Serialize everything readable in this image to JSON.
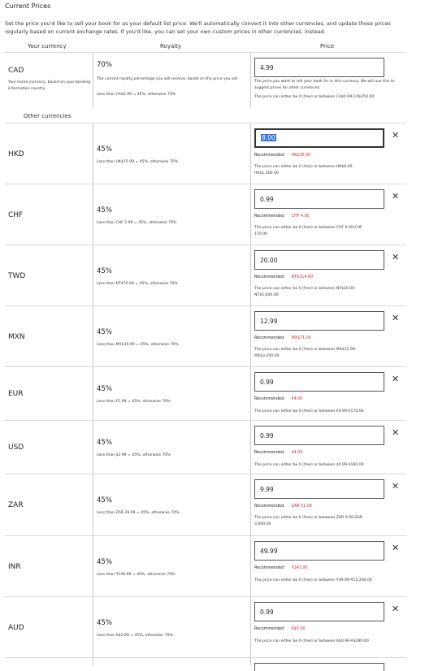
{
  "header": {
    "title": "Current Prices",
    "intro": "Set the price you'd like to sell your book for as your default list price. We'll automatically convert it into other currencies, and update those prices regularly based on current exchange rates. If you'd like, you can set your own custom prices in other currencies, instead."
  },
  "columns": {
    "your_currency": "Your currency",
    "royalty": "Royalty",
    "price": "Price"
  },
  "home": {
    "currency": "CAD",
    "currency_desc": "Your home currency, based on your banking information country.",
    "royalty": "70%",
    "royalty_desc": "The current royalty percentage you will receive, based on the price you set.",
    "royalty_rule": "Less than CA$2.99 = 45%, otherwise 70%",
    "price": "4.99",
    "price_desc": "The price you want to sell your book for in this currency. We will use this to suggest prices for other currencies.",
    "price_range": "The price can either be 0 (free) or between CA$0.99-CA$250.00"
  },
  "other_label": "Other currencies",
  "recommended_label": "Recommended:",
  "rows": [
    {
      "currency": "HKD",
      "royalty": "45%",
      "rule": "Less than HK$15.99 = 45%, otherwise 70%",
      "price": "8.00",
      "recommended": "HK$30.00",
      "range": "The price can either be 0 (free) or between HK$8.00-HK$1,500.00"
    },
    {
      "currency": "CHF",
      "royalty": "45%",
      "rule": "Less than CHF 2.99 = 45%, otherwise 70%",
      "price": "0.99",
      "recommended": "CHF 4.00",
      "range": "The price can either be 0 (free) or between CHF 0.99-CHF 170.00"
    },
    {
      "currency": "TWD",
      "royalty": "45%",
      "rule": "Less than NT$70.00 = 45%, otherwise 70%",
      "price": "20.00",
      "recommended": "NT$114.00",
      "range": "The price can either be 0 (free) or between NT$20.00-NT$5,600.00"
    },
    {
      "currency": "MXN",
      "royalty": "45%",
      "rule": "Less than MX$39.99 = 45%, otherwise 70%",
      "price": "12.99",
      "recommended": "MX$71.00",
      "range": "The price can either be 0 (free) or between MX$12.99-MX$3,200.00"
    },
    {
      "currency": "EUR",
      "royalty": "45%",
      "rule": "Less than €1.99 = 45%, otherwise 70%",
      "price": "0.99",
      "recommended": "€4.00",
      "range": "The price can either be 0 (free) or between €0.99-€170.00"
    },
    {
      "currency": "USD",
      "royalty": "45%",
      "rule": "Less than $2.99 = 45%, otherwise 70%",
      "price": "0.99",
      "recommended": "$4.00",
      "range": "The price can either be 0 (free) or between $0.99-$180.00"
    },
    {
      "currency": "ZAR",
      "royalty": "45%",
      "rule": "Less than ZAR 29.99 = 45%, otherwise 70%",
      "price": "9.99",
      "recommended": "ZAR 51.00",
      "range": "The price can either be 0 (free) or between ZAR 9.99-ZAR 3,600.00"
    },
    {
      "currency": "INR",
      "royalty": "45%",
      "rule": "Less than ₹149.99 = 45%, otherwise 70%",
      "price": "49.99",
      "recommended": "₹243.00",
      "range": "The price can either be 0 (free) or between ₹49.99-₹15,200.00"
    },
    {
      "currency": "AUD",
      "royalty": "45%",
      "rule": "Less than A$2.99 = 45%, otherwise 70%",
      "price": "0.99",
      "recommended": "A$5.00",
      "range": "The price can either be 0 (free) or between A$0.99-A$280.00"
    }
  ],
  "icons": {
    "remove": "close-icon"
  }
}
